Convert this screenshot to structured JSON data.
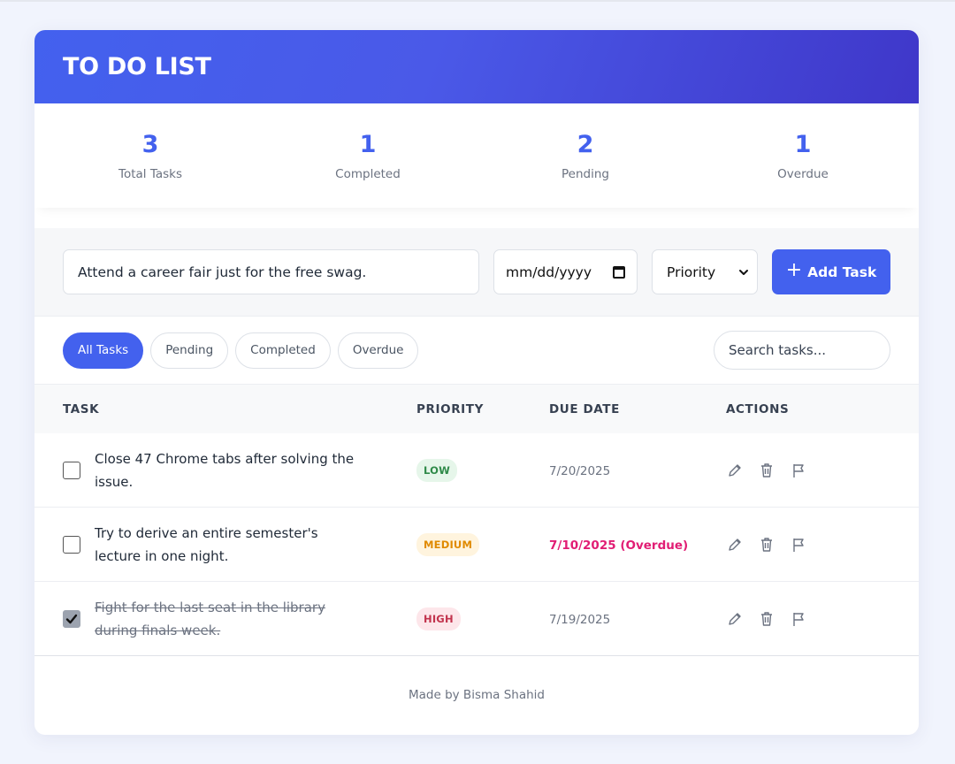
{
  "header": {
    "title": "TO DO LIST"
  },
  "stats": [
    {
      "value": "3",
      "label": "Total Tasks"
    },
    {
      "value": "1",
      "label": "Completed"
    },
    {
      "value": "2",
      "label": "Pending"
    },
    {
      "value": "1",
      "label": "Overdue"
    }
  ],
  "add_form": {
    "task_value": "Attend a career fair just for the free swag.",
    "date_placeholder": "mm/dd/yyyy",
    "priority_value": "Priority",
    "add_label": "Add Task",
    "add_icon": "plus-icon"
  },
  "filters": [
    {
      "label": "All Tasks",
      "active": true
    },
    {
      "label": "Pending",
      "active": false
    },
    {
      "label": "Completed",
      "active": false
    },
    {
      "label": "Overdue",
      "active": false
    }
  ],
  "search": {
    "placeholder": "Search tasks..."
  },
  "table": {
    "headers": {
      "task": "TASK",
      "priority": "PRIORITY",
      "due": "DUE DATE",
      "actions": "ACTIONS"
    },
    "rows": [
      {
        "text": "Close 47 Chrome tabs after solving the issue.",
        "done": false,
        "priority": "LOW",
        "due": "7/20/2025",
        "overdue": false
      },
      {
        "text": "Try to derive an entire semester's lecture in one night.",
        "done": false,
        "priority": "MEDIUM",
        "due": "7/10/2025 (Overdue)",
        "overdue": true
      },
      {
        "text": "Fight for the last seat in the library during finals week.",
        "done": true,
        "priority": "HIGH",
        "due": "7/19/2025",
        "overdue": false
      }
    ],
    "action_icons": [
      "pencil-icon",
      "trash-icon",
      "flag-icon"
    ]
  },
  "footer": {
    "text": "Made by Bisma Shahid"
  },
  "colors": {
    "accent": "#4361ee",
    "header_gradient_end": "#3f37c9",
    "overdue": "#e11d74",
    "low": "#2f8a49",
    "medium": "#e08a00",
    "high": "#c2334d"
  }
}
